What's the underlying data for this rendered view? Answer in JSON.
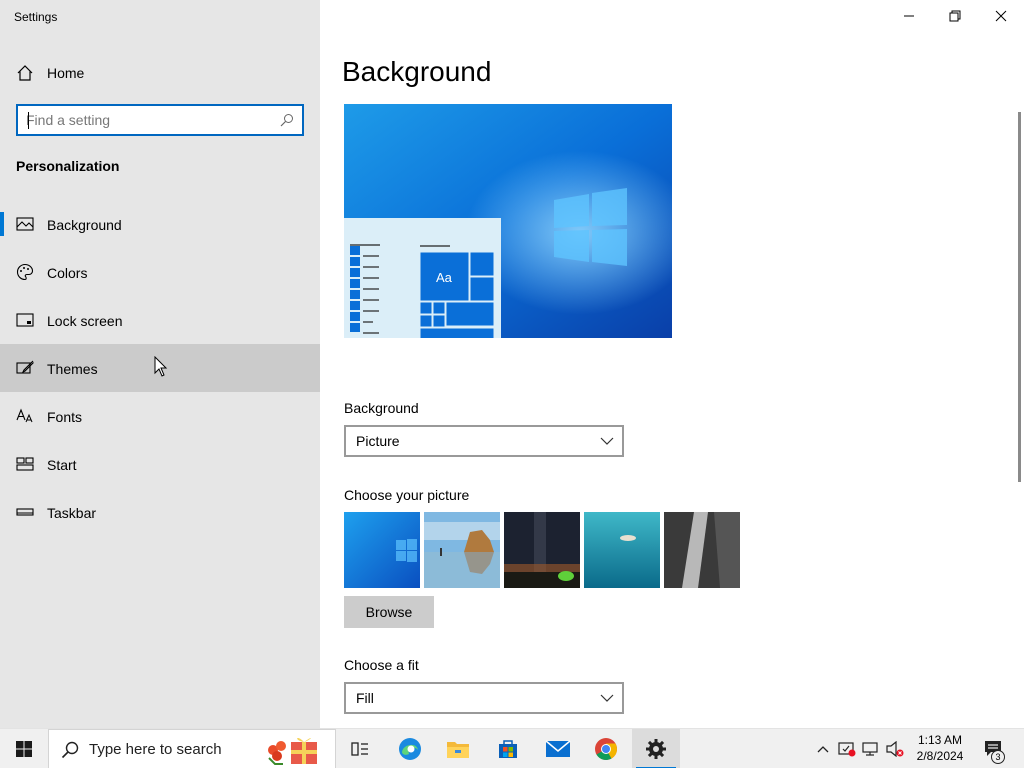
{
  "window": {
    "title": "Settings"
  },
  "sidebar": {
    "home_label": "Home",
    "search_placeholder": "Find a setting",
    "section_title": "Personalization",
    "items": [
      {
        "label": "Background",
        "icon": "picture-icon",
        "active": true
      },
      {
        "label": "Colors",
        "icon": "palette-icon"
      },
      {
        "label": "Lock screen",
        "icon": "lock-screen-icon"
      },
      {
        "label": "Themes",
        "icon": "brush-icon",
        "hover": true
      },
      {
        "label": "Fonts",
        "icon": "fonts-icon"
      },
      {
        "label": "Start",
        "icon": "start-icon"
      },
      {
        "label": "Taskbar",
        "icon": "taskbar-icon"
      }
    ]
  },
  "main": {
    "title": "Background",
    "preview_sample_text": "Aa",
    "background_label": "Background",
    "background_value": "Picture",
    "choose_picture_label": "Choose your picture",
    "pictures": [
      "windows-light-wallpaper",
      "beach-rocks",
      "night-sky-tent",
      "underwater-swimmer",
      "rock-waterfall"
    ],
    "browse_label": "Browse",
    "fit_label": "Choose a fit",
    "fit_value": "Fill"
  },
  "taskbar": {
    "search_placeholder": "Type here to search",
    "apps": [
      "task-view-icon",
      "edge-icon",
      "file-explorer-icon",
      "store-icon",
      "mail-icon",
      "chrome-icon",
      "settings-icon"
    ],
    "clock_time": "1:13 AM",
    "clock_date": "2/8/2024",
    "notification_count": "3"
  },
  "colors": {
    "accent": "#0078d4",
    "sidebar_bg": "#e6e6e6",
    "hover_bg": "#cbcbcb"
  }
}
